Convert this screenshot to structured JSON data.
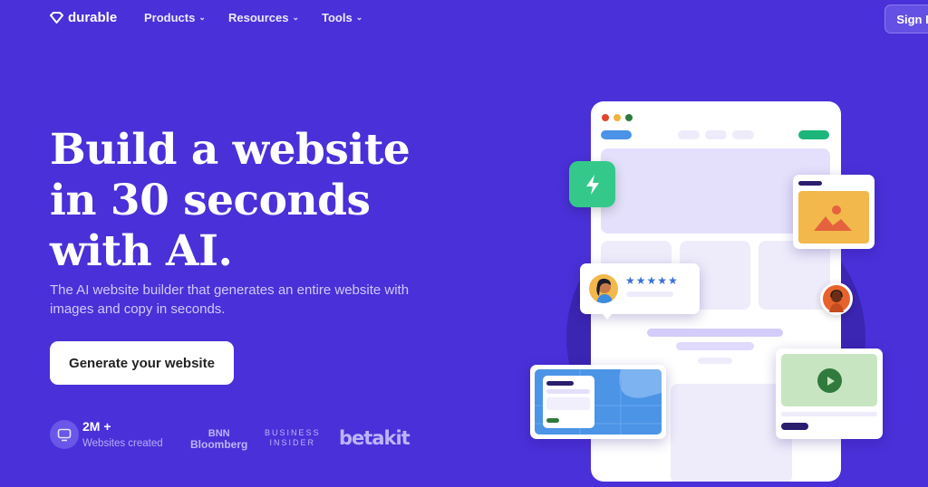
{
  "nav": {
    "logo": "durable",
    "items": [
      {
        "label": "Products",
        "icon": "chevron-down-icon"
      },
      {
        "label": "Resources",
        "icon": "chevron-down-icon"
      },
      {
        "label": "Tools",
        "icon": "chevron-down-icon"
      }
    ],
    "signin": "Sign In"
  },
  "hero": {
    "headline": [
      "Build a website",
      "in 30 seconds",
      "with AI."
    ],
    "subtitle": "The AI website builder that generates an entire website with images and copy in seconds.",
    "cta": "Generate your website"
  },
  "stats": {
    "icon": "monitor-icon",
    "number": "2M +",
    "label": "Websites created"
  },
  "press": {
    "bnn": [
      "BNN",
      "Bloomberg"
    ],
    "business_insider": [
      "BUSINESS",
      "INSIDER"
    ],
    "betakit": "betakit"
  },
  "illustration": {
    "rating_stars": "★★★★★",
    "colors": {
      "background": "#4a30d8",
      "accent_green": "#34c98a",
      "image_card": "#f2b84b",
      "video_card": "#c7e5c0",
      "map": "#4b94e6"
    }
  }
}
